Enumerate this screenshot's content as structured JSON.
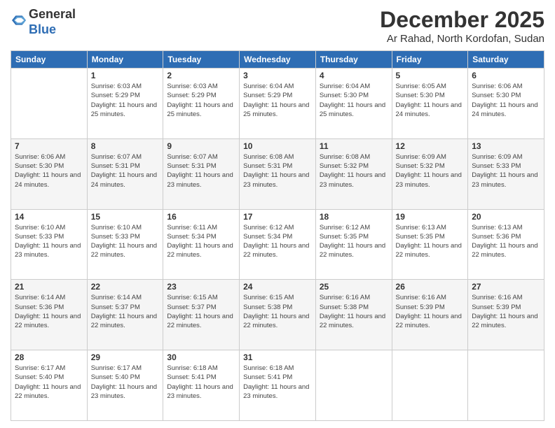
{
  "logo": {
    "general": "General",
    "blue": "Blue"
  },
  "header": {
    "month": "December 2025",
    "location": "Ar Rahad, North Kordofan, Sudan"
  },
  "weekdays": [
    "Sunday",
    "Monday",
    "Tuesday",
    "Wednesday",
    "Thursday",
    "Friday",
    "Saturday"
  ],
  "weeks": [
    [
      {
        "date": "",
        "sunrise": "",
        "sunset": "",
        "daylight": ""
      },
      {
        "date": "1",
        "sunrise": "Sunrise: 6:03 AM",
        "sunset": "Sunset: 5:29 PM",
        "daylight": "Daylight: 11 hours and 25 minutes."
      },
      {
        "date": "2",
        "sunrise": "Sunrise: 6:03 AM",
        "sunset": "Sunset: 5:29 PM",
        "daylight": "Daylight: 11 hours and 25 minutes."
      },
      {
        "date": "3",
        "sunrise": "Sunrise: 6:04 AM",
        "sunset": "Sunset: 5:29 PM",
        "daylight": "Daylight: 11 hours and 25 minutes."
      },
      {
        "date": "4",
        "sunrise": "Sunrise: 6:04 AM",
        "sunset": "Sunset: 5:30 PM",
        "daylight": "Daylight: 11 hours and 25 minutes."
      },
      {
        "date": "5",
        "sunrise": "Sunrise: 6:05 AM",
        "sunset": "Sunset: 5:30 PM",
        "daylight": "Daylight: 11 hours and 24 minutes."
      },
      {
        "date": "6",
        "sunrise": "Sunrise: 6:06 AM",
        "sunset": "Sunset: 5:30 PM",
        "daylight": "Daylight: 11 hours and 24 minutes."
      }
    ],
    [
      {
        "date": "7",
        "sunrise": "Sunrise: 6:06 AM",
        "sunset": "Sunset: 5:30 PM",
        "daylight": "Daylight: 11 hours and 24 minutes."
      },
      {
        "date": "8",
        "sunrise": "Sunrise: 6:07 AM",
        "sunset": "Sunset: 5:31 PM",
        "daylight": "Daylight: 11 hours and 24 minutes."
      },
      {
        "date": "9",
        "sunrise": "Sunrise: 6:07 AM",
        "sunset": "Sunset: 5:31 PM",
        "daylight": "Daylight: 11 hours and 23 minutes."
      },
      {
        "date": "10",
        "sunrise": "Sunrise: 6:08 AM",
        "sunset": "Sunset: 5:31 PM",
        "daylight": "Daylight: 11 hours and 23 minutes."
      },
      {
        "date": "11",
        "sunrise": "Sunrise: 6:08 AM",
        "sunset": "Sunset: 5:32 PM",
        "daylight": "Daylight: 11 hours and 23 minutes."
      },
      {
        "date": "12",
        "sunrise": "Sunrise: 6:09 AM",
        "sunset": "Sunset: 5:32 PM",
        "daylight": "Daylight: 11 hours and 23 minutes."
      },
      {
        "date": "13",
        "sunrise": "Sunrise: 6:09 AM",
        "sunset": "Sunset: 5:33 PM",
        "daylight": "Daylight: 11 hours and 23 minutes."
      }
    ],
    [
      {
        "date": "14",
        "sunrise": "Sunrise: 6:10 AM",
        "sunset": "Sunset: 5:33 PM",
        "daylight": "Daylight: 11 hours and 23 minutes."
      },
      {
        "date": "15",
        "sunrise": "Sunrise: 6:10 AM",
        "sunset": "Sunset: 5:33 PM",
        "daylight": "Daylight: 11 hours and 22 minutes."
      },
      {
        "date": "16",
        "sunrise": "Sunrise: 6:11 AM",
        "sunset": "Sunset: 5:34 PM",
        "daylight": "Daylight: 11 hours and 22 minutes."
      },
      {
        "date": "17",
        "sunrise": "Sunrise: 6:12 AM",
        "sunset": "Sunset: 5:34 PM",
        "daylight": "Daylight: 11 hours and 22 minutes."
      },
      {
        "date": "18",
        "sunrise": "Sunrise: 6:12 AM",
        "sunset": "Sunset: 5:35 PM",
        "daylight": "Daylight: 11 hours and 22 minutes."
      },
      {
        "date": "19",
        "sunrise": "Sunrise: 6:13 AM",
        "sunset": "Sunset: 5:35 PM",
        "daylight": "Daylight: 11 hours and 22 minutes."
      },
      {
        "date": "20",
        "sunrise": "Sunrise: 6:13 AM",
        "sunset": "Sunset: 5:36 PM",
        "daylight": "Daylight: 11 hours and 22 minutes."
      }
    ],
    [
      {
        "date": "21",
        "sunrise": "Sunrise: 6:14 AM",
        "sunset": "Sunset: 5:36 PM",
        "daylight": "Daylight: 11 hours and 22 minutes."
      },
      {
        "date": "22",
        "sunrise": "Sunrise: 6:14 AM",
        "sunset": "Sunset: 5:37 PM",
        "daylight": "Daylight: 11 hours and 22 minutes."
      },
      {
        "date": "23",
        "sunrise": "Sunrise: 6:15 AM",
        "sunset": "Sunset: 5:37 PM",
        "daylight": "Daylight: 11 hours and 22 minutes."
      },
      {
        "date": "24",
        "sunrise": "Sunrise: 6:15 AM",
        "sunset": "Sunset: 5:38 PM",
        "daylight": "Daylight: 11 hours and 22 minutes."
      },
      {
        "date": "25",
        "sunrise": "Sunrise: 6:16 AM",
        "sunset": "Sunset: 5:38 PM",
        "daylight": "Daylight: 11 hours and 22 minutes."
      },
      {
        "date": "26",
        "sunrise": "Sunrise: 6:16 AM",
        "sunset": "Sunset: 5:39 PM",
        "daylight": "Daylight: 11 hours and 22 minutes."
      },
      {
        "date": "27",
        "sunrise": "Sunrise: 6:16 AM",
        "sunset": "Sunset: 5:39 PM",
        "daylight": "Daylight: 11 hours and 22 minutes."
      }
    ],
    [
      {
        "date": "28",
        "sunrise": "Sunrise: 6:17 AM",
        "sunset": "Sunset: 5:40 PM",
        "daylight": "Daylight: 11 hours and 22 minutes."
      },
      {
        "date": "29",
        "sunrise": "Sunrise: 6:17 AM",
        "sunset": "Sunset: 5:40 PM",
        "daylight": "Daylight: 11 hours and 23 minutes."
      },
      {
        "date": "30",
        "sunrise": "Sunrise: 6:18 AM",
        "sunset": "Sunset: 5:41 PM",
        "daylight": "Daylight: 11 hours and 23 minutes."
      },
      {
        "date": "31",
        "sunrise": "Sunrise: 6:18 AM",
        "sunset": "Sunset: 5:41 PM",
        "daylight": "Daylight: 11 hours and 23 minutes."
      },
      {
        "date": "",
        "sunrise": "",
        "sunset": "",
        "daylight": ""
      },
      {
        "date": "",
        "sunrise": "",
        "sunset": "",
        "daylight": ""
      },
      {
        "date": "",
        "sunrise": "",
        "sunset": "",
        "daylight": ""
      }
    ]
  ]
}
